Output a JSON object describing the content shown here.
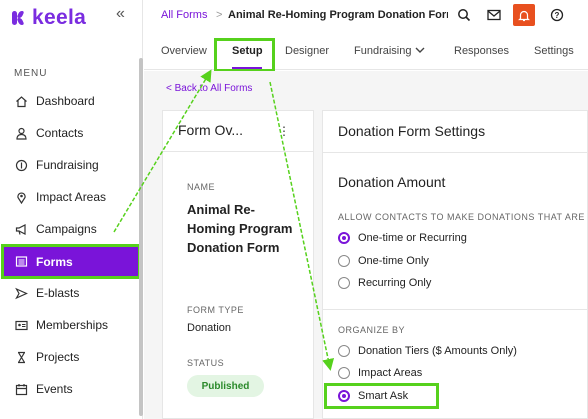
{
  "brand": {
    "name": "keela",
    "collapse_icon": "«"
  },
  "sidebar": {
    "menu_label": "MENU",
    "items": [
      {
        "label": "Dashboard",
        "icon": "home-icon"
      },
      {
        "label": "Contacts",
        "icon": "person-icon"
      },
      {
        "label": "Fundraising",
        "icon": "coin-icon"
      },
      {
        "label": "Impact Areas",
        "icon": "pin-icon"
      },
      {
        "label": "Campaigns",
        "icon": "megaphone-icon"
      },
      {
        "label": "Forms",
        "icon": "list-icon",
        "active": true
      },
      {
        "label": "E-blasts",
        "icon": "send-icon"
      },
      {
        "label": "Memberships",
        "icon": "id-card-icon"
      },
      {
        "label": "Projects",
        "icon": "hourglass-icon"
      },
      {
        "label": "Events",
        "icon": "calendar-icon"
      }
    ]
  },
  "breadcrumb": {
    "link": "All Forms",
    "separator": ">",
    "current": "Animal Re-Homing Program Donation Forn"
  },
  "tabs": [
    "Overview",
    "Setup",
    "Designer",
    "Fundraising",
    "Responses",
    "Settings"
  ],
  "back_link": "< Back to All Forms",
  "form_overview": {
    "title": "Form Ov...",
    "kebab": "⋮",
    "name_label": "NAME",
    "name": "Animal Re-Homing Program Donation Form",
    "type_label": "FORM TYPE",
    "type": "Donation",
    "status_label": "STATUS",
    "status": "Published"
  },
  "settings": {
    "title": "Donation Form Settings",
    "section": "Donation Amount",
    "allow_label": "ALLOW CONTACTS TO MAKE DONATIONS THAT ARE",
    "allow_options": [
      {
        "label": "One-time or Recurring",
        "checked": true
      },
      {
        "label": "One-time Only",
        "checked": false
      },
      {
        "label": "Recurring Only",
        "checked": false
      }
    ],
    "organize_label": "ORGANIZE BY",
    "organize_options": [
      {
        "label": "Donation Tiers ($ Amounts Only)",
        "checked": false
      },
      {
        "label": "Impact Areas",
        "checked": false
      },
      {
        "label": "Smart Ask",
        "checked": true
      }
    ]
  },
  "colors": {
    "accent": "#7a14d9",
    "highlight": "#56d11c",
    "bell": "#e8501f",
    "published_bg": "#e3f5e3"
  }
}
